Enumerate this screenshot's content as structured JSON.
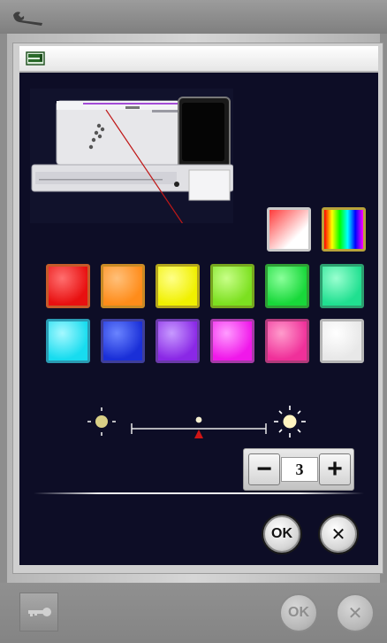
{
  "icons": {
    "settings": "wrench-icon",
    "machine": "sewing-machine-icon",
    "dim": "sun-dim-icon",
    "bright": "sun-bright-icon",
    "lock": "key-icon"
  },
  "palette": {
    "row0": [
      {
        "name": "white-gradient",
        "colors": [
          "#ff3b3b",
          "#ffffff"
        ]
      },
      {
        "name": "rainbow",
        "colors": [
          "#ff0000",
          "#ffff00",
          "#00ff00",
          "#00ffff",
          "#0000ff",
          "#ff00ff"
        ]
      }
    ],
    "row1": [
      "#e81010",
      "#ff8c1a",
      "#f0f000",
      "#7ce020",
      "#18d83a",
      "#20e090"
    ],
    "row2": [
      "#18dcef",
      "#1a2fd8",
      "#8a28e6",
      "#f018ea",
      "#f0309a",
      "#f4f4f4"
    ]
  },
  "brightness": {
    "level": 0.5
  },
  "stepper": {
    "minus": "−",
    "value": "3",
    "plus": "+"
  },
  "buttons": {
    "ok": "OK",
    "cancel": "✕"
  },
  "bottom": {
    "ok": "OK",
    "cancel": "✕"
  }
}
